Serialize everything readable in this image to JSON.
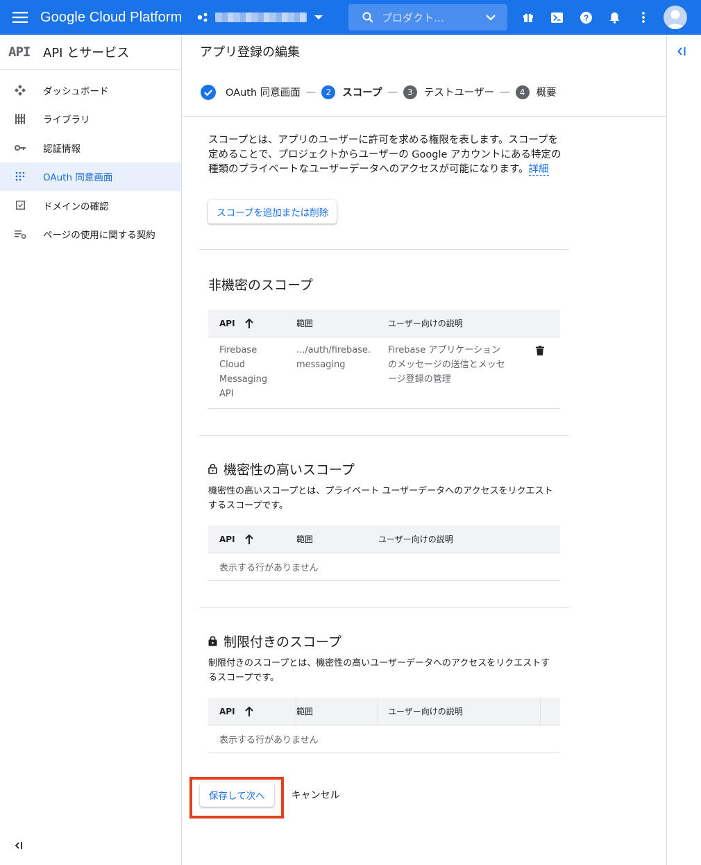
{
  "header": {
    "brand": "Google Cloud Platform",
    "search_placeholder": "プロダクト…",
    "icons": [
      "gift-icon",
      "cloud-shell-icon",
      "help-icon",
      "notifications-icon",
      "more-vert-icon",
      "account-avatar-icon"
    ]
  },
  "sidebar": {
    "logo": "API",
    "title": "API とサービス",
    "items": [
      {
        "label": "ダッシュボード",
        "icon": "dashboard-icon"
      },
      {
        "label": "ライブラリ",
        "icon": "library-icon"
      },
      {
        "label": "認証情報",
        "icon": "key-icon"
      },
      {
        "label": "OAuth 同意画面",
        "icon": "oauth-grid-icon",
        "active": true
      },
      {
        "label": "ドメインの確認",
        "icon": "checkbox-icon"
      },
      {
        "label": "ページの使用に関する契約",
        "icon": "settings-list-icon"
      }
    ]
  },
  "page": {
    "title": "アプリ登録の編集"
  },
  "stepper": {
    "steps": [
      {
        "label": "OAuth 同意画面",
        "state": "done"
      },
      {
        "number": "2",
        "label": "スコープ",
        "state": "current"
      },
      {
        "number": "3",
        "label": "テストユーザー",
        "state": "todo"
      },
      {
        "number": "4",
        "label": "概要",
        "state": "todo"
      }
    ],
    "separator": "—"
  },
  "intro": {
    "text": "スコープとは、アプリのユーザーに許可を求める権限を表します。スコープを定めることで、プロジェクトからユーザーの Google アカウントにある特定の種類のプライベートなユーザーデータへのアクセスが可能になります。",
    "link": "詳細"
  },
  "add_scope_button": "スコープを追加または削除",
  "non_sensitive": {
    "title": "非機密のスコープ",
    "columns": [
      "API",
      "範囲",
      "ユーザー向けの説明"
    ],
    "rows": [
      {
        "api": "Firebase Cloud Messaging API",
        "scope": ".../auth/firebase.messaging",
        "description": "Firebase アプリケーションのメッセージの送信とメッセージ登録の管理"
      }
    ]
  },
  "sensitive": {
    "title": "機密性の高いスコープ",
    "description": "機密性の高いスコープとは、プライベート ユーザーデータへのアクセスをリクエストするスコープです。",
    "columns": [
      "API",
      "範囲",
      "ユーザー向けの説明"
    ],
    "empty": "表示する行がありません"
  },
  "restricted": {
    "title": "制限付きのスコープ",
    "description": "制限付きのスコープとは、機密性の高いユーザーデータへのアクセスをリクエストするスコープです。",
    "columns": [
      "API",
      "範囲",
      "ユーザー向けの説明"
    ],
    "empty": "表示する行がありません"
  },
  "actions": {
    "save": "保存して次へ",
    "cancel": "キャンセル"
  },
  "colors": {
    "brand_blue": "#1a73e8",
    "highlight_red": "#e2401e",
    "active_bg": "#e8f0fe"
  }
}
